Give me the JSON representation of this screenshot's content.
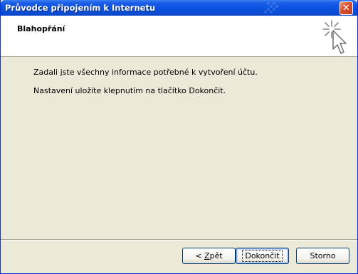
{
  "window": {
    "title": "Průvodce připojením k Internetu",
    "close_glyph": "✕"
  },
  "header": {
    "title": "Blahopřání",
    "icon": "wizard-cursor-sparkle-icon"
  },
  "content": {
    "line1": "Zadali jste všechny informace potřebné k vytvoření účtu.",
    "line2": "Nastavení uložíte klepnutím na tlačítko Dokončit."
  },
  "buttons": {
    "back_prefix": "< ",
    "back_hotkey": "Z",
    "back_rest": "pět",
    "finish": "Dokončit",
    "cancel": "Storno"
  },
  "colors": {
    "titlebar": "#0a4fd8",
    "dialog_bg": "#ece9d8",
    "header_bg": "#ffffff",
    "button_border": "#003c74"
  }
}
